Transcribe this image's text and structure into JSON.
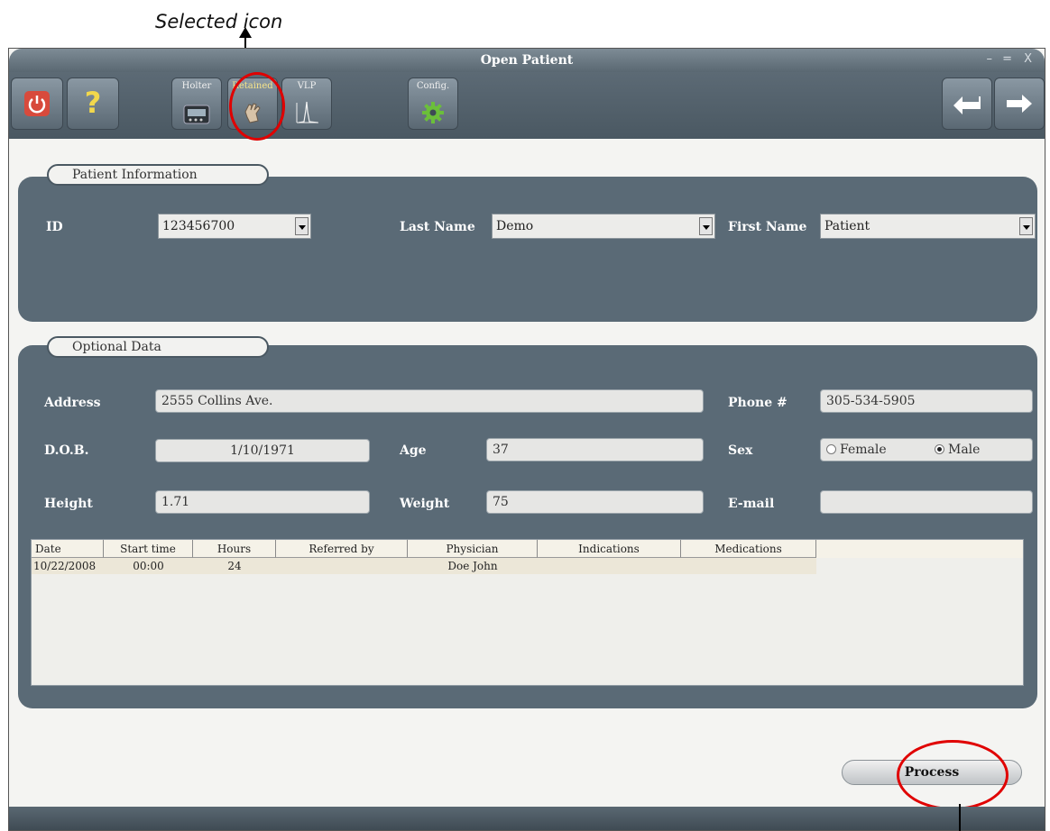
{
  "annotation": {
    "selected_icon_label": "Selected icon"
  },
  "window": {
    "title": "Open Patient",
    "controls": {
      "minimize": "–",
      "maximize": "=",
      "close": "X"
    }
  },
  "toolbar": {
    "power": {
      "icon": "power-icon"
    },
    "help": {
      "icon": "help-icon",
      "glyph": "?"
    },
    "modules": [
      {
        "label": "Holter",
        "icon": "holter-recorder-icon",
        "selected": false
      },
      {
        "label": "Retained",
        "icon": "retained-hand-icon",
        "selected": true
      },
      {
        "label": "VLP",
        "icon": "vlp-waveform-icon",
        "selected": false
      }
    ],
    "config": {
      "label": "Config.",
      "icon": "gear-icon"
    },
    "back": {
      "icon": "back-arrow-icon"
    },
    "forward": {
      "icon": "forward-arrow-icon"
    }
  },
  "patient_info": {
    "tab_label": "Patient Information",
    "id_label": "ID",
    "id_value": "123456700",
    "last_name_label": "Last Name",
    "last_name_value": "Demo",
    "first_name_label": "First Name",
    "first_name_value": "Patient"
  },
  "optional_data": {
    "tab_label": "Optional Data",
    "address_label": "Address",
    "address_value": "2555 Collins Ave.",
    "phone_label": "Phone #",
    "phone_value": "305-534-5905",
    "dob_label": "D.O.B.",
    "dob_value": "1/10/1971",
    "age_label": "Age",
    "age_value": "37",
    "sex_label": "Sex",
    "sex_options": [
      "Female",
      "Male"
    ],
    "sex_selected": "Male",
    "height_label": "Height",
    "height_value": "1.71",
    "weight_label": "Weight",
    "weight_value": "75",
    "email_label": "E-mail",
    "email_value": ""
  },
  "recordings": {
    "columns": [
      "Date",
      "Start time",
      "Hours",
      "Referred by",
      "Physician",
      "Indications",
      "Medications"
    ],
    "rows": [
      [
        "10/22/2008",
        "00:00",
        "24",
        "",
        "Doe John",
        "",
        ""
      ]
    ]
  },
  "process_button": {
    "label": "Process"
  },
  "colors": {
    "panel": "#5a6a76",
    "highlight_circle": "#e00000",
    "selected_label": "#f6e48a"
  }
}
